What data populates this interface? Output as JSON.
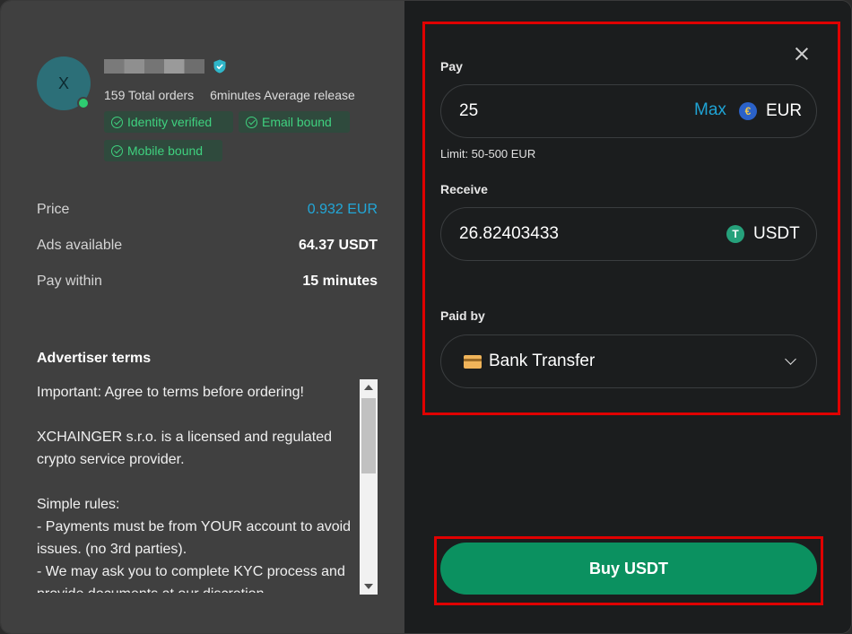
{
  "advertiser": {
    "avatar_initial": "X",
    "total_orders": "159 Total orders",
    "avg_release": "6minutes Average release",
    "badges": [
      "Identity verified",
      "Email bound",
      "Mobile bound"
    ]
  },
  "details": {
    "price_label": "Price",
    "price_value": "0.932 EUR",
    "ads_label": "Ads available",
    "ads_value": "64.37 USDT",
    "pay_within_label": "Pay within",
    "pay_within_value": "15 minutes"
  },
  "terms": {
    "title": "Advertiser terms",
    "text": "Important: Agree to terms before ordering!\n\nXCHAINGER s.r.o. is a licensed and regulated crypto service provider.\n\nSimple rules:\n- Payments must be from YOUR account to avoid issues. (no 3rd parties).\n- We may ask you to complete KYC process and provide documents at our discretion."
  },
  "order_form": {
    "pay_label": "Pay",
    "pay_value": "25",
    "max_label": "Max",
    "pay_currency": "EUR",
    "limit": "Limit: 50-500 EUR",
    "receive_label": "Receive",
    "receive_value": "26.82403433",
    "receive_currency": "USDT",
    "paid_by_label": "Paid by",
    "payment_method": "Bank Transfer",
    "buy_button": "Buy USDT"
  },
  "icons": {
    "close": "close-icon",
    "eur": "euro-coin-icon",
    "usdt": "tether-icon",
    "bank": "bank-card-icon",
    "chevron": "chevron-down-icon",
    "verified": "verified-shield-icon"
  },
  "colors": {
    "accent": "#22a7d8",
    "buy": "#0b9160",
    "badge_text": "#3fd17f",
    "highlight": "#e00000"
  }
}
